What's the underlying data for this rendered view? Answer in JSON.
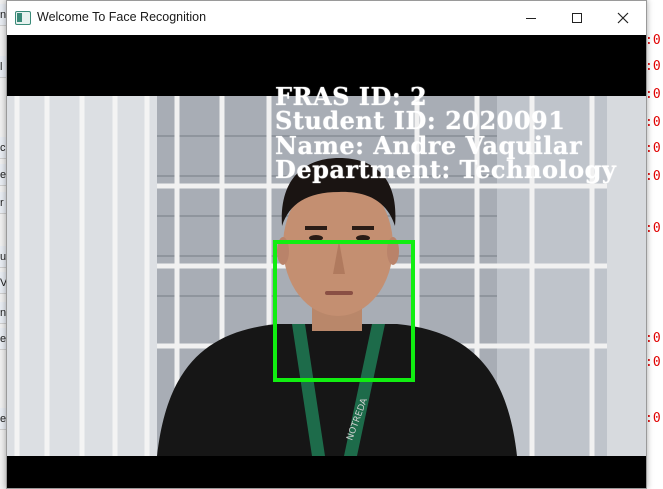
{
  "window": {
    "title": "Welcome To Face Recognition"
  },
  "recognition": {
    "fras_id_line": "FRAS ID: 2",
    "student_id_line": "Student ID: 2020091",
    "name_line": "Name: Andre Vaquilar",
    "department_line": "Department: Technology",
    "box_color": "#11ee11"
  },
  "lanyard_text": "NOTREDA",
  "background_app": {
    "right_cells": [
      ":0",
      ":0",
      ":0",
      ":0",
      ":0",
      ":0",
      ":0",
      ":0",
      ":0",
      ":0"
    ],
    "left_cells": [
      "n",
      "l",
      "c",
      "e",
      "r",
      "u",
      "V",
      "n",
      "e",
      "e"
    ]
  },
  "icons": {
    "minimize": "minimize-icon",
    "maximize": "maximize-icon",
    "close": "close-icon"
  }
}
